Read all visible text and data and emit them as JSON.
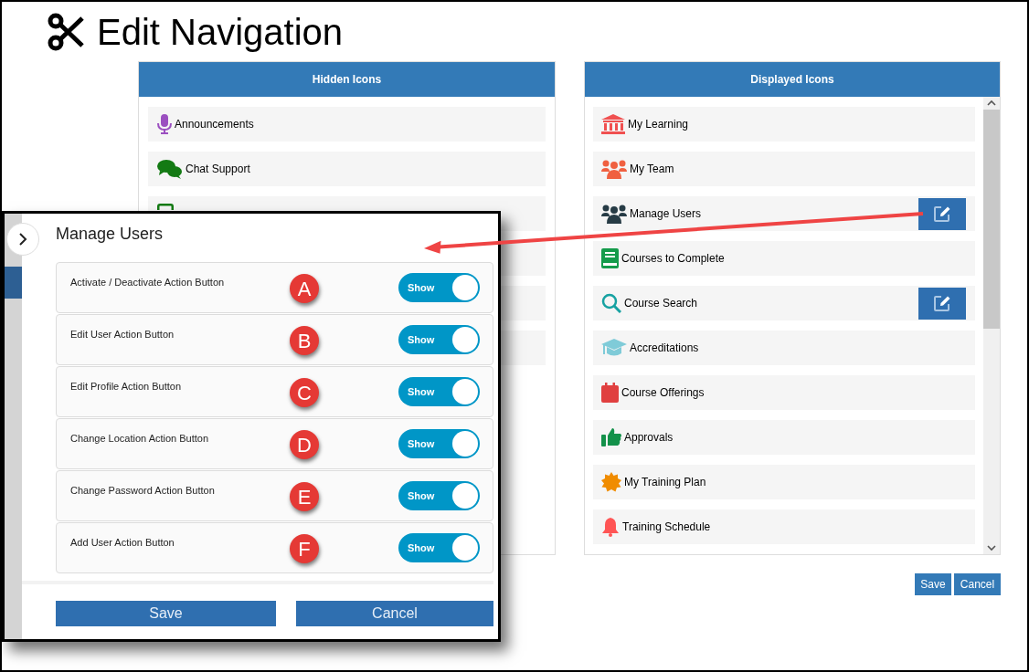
{
  "page_title": "Edit Navigation",
  "hidden_panel": {
    "title": "Hidden Icons",
    "items": [
      {
        "kind": "item",
        "label": "Announcements"
      },
      {
        "kind": "item",
        "label": "Chat Support"
      },
      {
        "kind": "covered"
      },
      {
        "kind": "covered"
      },
      {
        "kind": "covered"
      },
      {
        "kind": "covered"
      }
    ]
  },
  "displayed_panel": {
    "title": "Displayed Icons",
    "items": [
      {
        "label": "My Learning",
        "editable": false
      },
      {
        "label": "My Team",
        "editable": false
      },
      {
        "label": "Manage Users",
        "editable": true
      },
      {
        "label": "Courses to Complete",
        "editable": false
      },
      {
        "label": "Course Search",
        "editable": true
      },
      {
        "label": "Accreditations",
        "editable": false
      },
      {
        "label": "Course Offerings",
        "editable": false
      },
      {
        "label": "Approvals",
        "editable": false
      },
      {
        "label": "My Training Plan",
        "editable": false
      },
      {
        "label": "Training Schedule",
        "editable": false
      }
    ]
  },
  "buttons": [
    "Save",
    "Cancel"
  ],
  "dialog": {
    "title": "Manage Users",
    "rows": [
      {
        "label": "Activate / Deactivate Action Button",
        "badge": "A",
        "color": "#e53935",
        "toggle": "Show",
        "on": true
      },
      {
        "label": "Edit User Action Button",
        "badge": "B",
        "color": "#e53935",
        "toggle": "Show",
        "on": true
      },
      {
        "label": "Edit Profile Action Button",
        "badge": "C",
        "color": "#e53935",
        "toggle": "Show",
        "on": true
      },
      {
        "label": "Change Location Action Button",
        "badge": "D",
        "color": "#e53935",
        "toggle": "Show",
        "on": true
      },
      {
        "label": "Change Password Action Button",
        "badge": "E",
        "color": "#e53935",
        "toggle": "Show",
        "on": true
      },
      {
        "label": "Add User Action Button",
        "badge": "F",
        "color": "#e53935",
        "toggle": "Show",
        "on": true
      }
    ],
    "buttons": [
      "Save",
      "Cancel"
    ]
  }
}
